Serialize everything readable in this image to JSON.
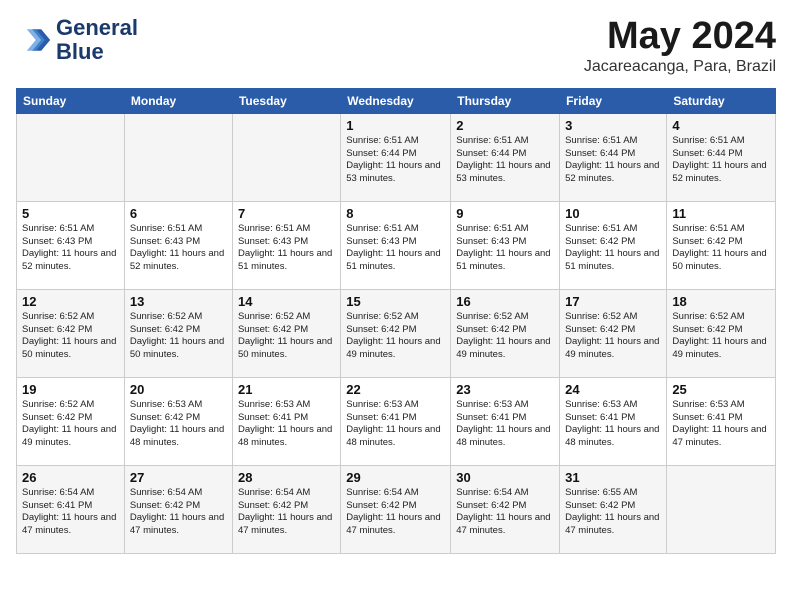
{
  "logo": {
    "line1": "General",
    "line2": "Blue"
  },
  "title": "May 2024",
  "location": "Jacareacanga, Para, Brazil",
  "weekdays": [
    "Sunday",
    "Monday",
    "Tuesday",
    "Wednesday",
    "Thursday",
    "Friday",
    "Saturday"
  ],
  "weeks": [
    [
      {
        "day": "",
        "info": ""
      },
      {
        "day": "",
        "info": ""
      },
      {
        "day": "",
        "info": ""
      },
      {
        "day": "1",
        "info": "Sunrise: 6:51 AM\nSunset: 6:44 PM\nDaylight: 11 hours and 53 minutes."
      },
      {
        "day": "2",
        "info": "Sunrise: 6:51 AM\nSunset: 6:44 PM\nDaylight: 11 hours and 53 minutes."
      },
      {
        "day": "3",
        "info": "Sunrise: 6:51 AM\nSunset: 6:44 PM\nDaylight: 11 hours and 52 minutes."
      },
      {
        "day": "4",
        "info": "Sunrise: 6:51 AM\nSunset: 6:44 PM\nDaylight: 11 hours and 52 minutes."
      }
    ],
    [
      {
        "day": "5",
        "info": "Sunrise: 6:51 AM\nSunset: 6:43 PM\nDaylight: 11 hours and 52 minutes."
      },
      {
        "day": "6",
        "info": "Sunrise: 6:51 AM\nSunset: 6:43 PM\nDaylight: 11 hours and 52 minutes."
      },
      {
        "day": "7",
        "info": "Sunrise: 6:51 AM\nSunset: 6:43 PM\nDaylight: 11 hours and 51 minutes."
      },
      {
        "day": "8",
        "info": "Sunrise: 6:51 AM\nSunset: 6:43 PM\nDaylight: 11 hours and 51 minutes."
      },
      {
        "day": "9",
        "info": "Sunrise: 6:51 AM\nSunset: 6:43 PM\nDaylight: 11 hours and 51 minutes."
      },
      {
        "day": "10",
        "info": "Sunrise: 6:51 AM\nSunset: 6:42 PM\nDaylight: 11 hours and 51 minutes."
      },
      {
        "day": "11",
        "info": "Sunrise: 6:51 AM\nSunset: 6:42 PM\nDaylight: 11 hours and 50 minutes."
      }
    ],
    [
      {
        "day": "12",
        "info": "Sunrise: 6:52 AM\nSunset: 6:42 PM\nDaylight: 11 hours and 50 minutes."
      },
      {
        "day": "13",
        "info": "Sunrise: 6:52 AM\nSunset: 6:42 PM\nDaylight: 11 hours and 50 minutes."
      },
      {
        "day": "14",
        "info": "Sunrise: 6:52 AM\nSunset: 6:42 PM\nDaylight: 11 hours and 50 minutes."
      },
      {
        "day": "15",
        "info": "Sunrise: 6:52 AM\nSunset: 6:42 PM\nDaylight: 11 hours and 49 minutes."
      },
      {
        "day": "16",
        "info": "Sunrise: 6:52 AM\nSunset: 6:42 PM\nDaylight: 11 hours and 49 minutes."
      },
      {
        "day": "17",
        "info": "Sunrise: 6:52 AM\nSunset: 6:42 PM\nDaylight: 11 hours and 49 minutes."
      },
      {
        "day": "18",
        "info": "Sunrise: 6:52 AM\nSunset: 6:42 PM\nDaylight: 11 hours and 49 minutes."
      }
    ],
    [
      {
        "day": "19",
        "info": "Sunrise: 6:52 AM\nSunset: 6:42 PM\nDaylight: 11 hours and 49 minutes."
      },
      {
        "day": "20",
        "info": "Sunrise: 6:53 AM\nSunset: 6:42 PM\nDaylight: 11 hours and 48 minutes."
      },
      {
        "day": "21",
        "info": "Sunrise: 6:53 AM\nSunset: 6:41 PM\nDaylight: 11 hours and 48 minutes."
      },
      {
        "day": "22",
        "info": "Sunrise: 6:53 AM\nSunset: 6:41 PM\nDaylight: 11 hours and 48 minutes."
      },
      {
        "day": "23",
        "info": "Sunrise: 6:53 AM\nSunset: 6:41 PM\nDaylight: 11 hours and 48 minutes."
      },
      {
        "day": "24",
        "info": "Sunrise: 6:53 AM\nSunset: 6:41 PM\nDaylight: 11 hours and 48 minutes."
      },
      {
        "day": "25",
        "info": "Sunrise: 6:53 AM\nSunset: 6:41 PM\nDaylight: 11 hours and 47 minutes."
      }
    ],
    [
      {
        "day": "26",
        "info": "Sunrise: 6:54 AM\nSunset: 6:41 PM\nDaylight: 11 hours and 47 minutes."
      },
      {
        "day": "27",
        "info": "Sunrise: 6:54 AM\nSunset: 6:42 PM\nDaylight: 11 hours and 47 minutes."
      },
      {
        "day": "28",
        "info": "Sunrise: 6:54 AM\nSunset: 6:42 PM\nDaylight: 11 hours and 47 minutes."
      },
      {
        "day": "29",
        "info": "Sunrise: 6:54 AM\nSunset: 6:42 PM\nDaylight: 11 hours and 47 minutes."
      },
      {
        "day": "30",
        "info": "Sunrise: 6:54 AM\nSunset: 6:42 PM\nDaylight: 11 hours and 47 minutes."
      },
      {
        "day": "31",
        "info": "Sunrise: 6:55 AM\nSunset: 6:42 PM\nDaylight: 11 hours and 47 minutes."
      },
      {
        "day": "",
        "info": ""
      }
    ]
  ]
}
